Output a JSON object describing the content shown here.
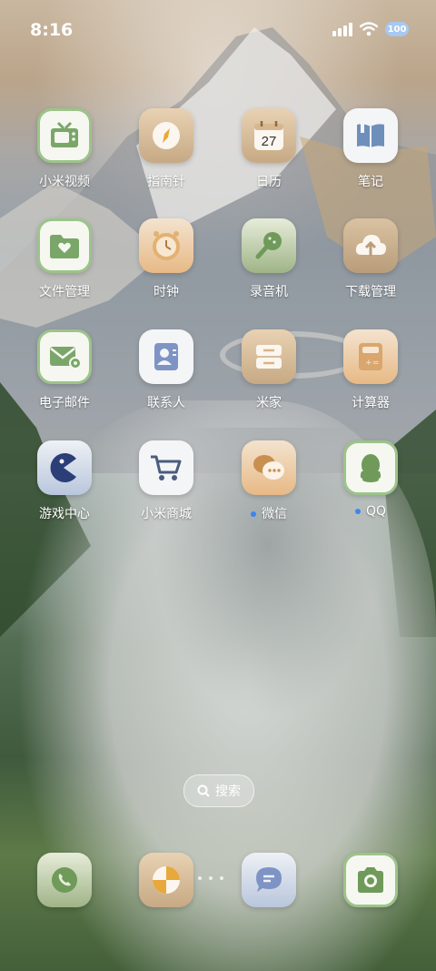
{
  "status_bar": {
    "time": "8:16",
    "battery": "100"
  },
  "apps": [
    {
      "label": "小米视频",
      "icon": "tv-icon"
    },
    {
      "label": "指南针",
      "icon": "compass-icon"
    },
    {
      "label": "日历",
      "icon": "calendar-icon",
      "date": "27"
    },
    {
      "label": "笔记",
      "icon": "notes-icon"
    },
    {
      "label": "文件管理",
      "icon": "folder-icon"
    },
    {
      "label": "时钟",
      "icon": "clock-icon"
    },
    {
      "label": "录音机",
      "icon": "microphone-icon"
    },
    {
      "label": "下载管理",
      "icon": "download-icon"
    },
    {
      "label": "电子邮件",
      "icon": "mail-icon"
    },
    {
      "label": "联系人",
      "icon": "contacts-icon"
    },
    {
      "label": "米家",
      "icon": "mihome-icon"
    },
    {
      "label": "计算器",
      "icon": "calculator-icon"
    },
    {
      "label": "游戏中心",
      "icon": "game-icon"
    },
    {
      "label": "小米商城",
      "icon": "shop-cart-icon"
    },
    {
      "label": "微信",
      "icon": "wechat-icon",
      "badge_dot": true
    },
    {
      "label": "QQ",
      "icon": "qq-icon",
      "badge_dot": true
    }
  ],
  "search": {
    "label": "搜索"
  },
  "dock": [
    {
      "name": "phone-icon"
    },
    {
      "name": "browser-icon"
    },
    {
      "name": "messages-icon"
    },
    {
      "name": "camera-icon"
    }
  ],
  "colors": {
    "accent_green": "#6f9a5a",
    "badge_blue": "#3b86f0"
  }
}
